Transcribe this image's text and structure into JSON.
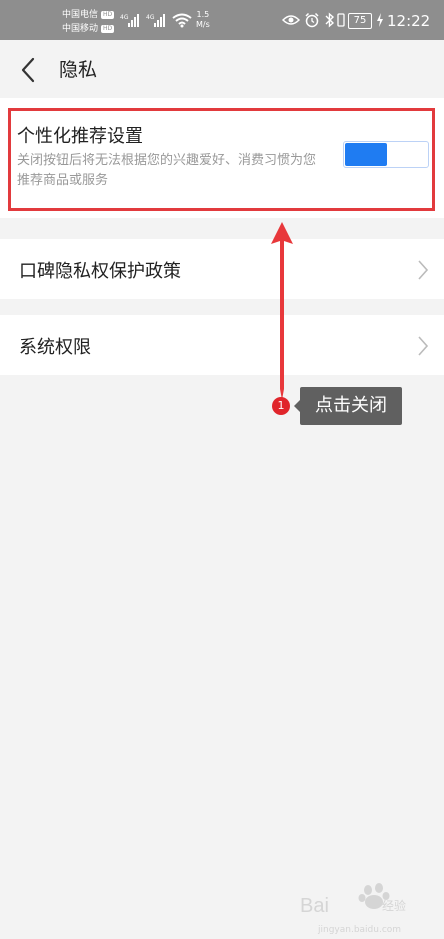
{
  "status_bar": {
    "carrier_1": "中国电信",
    "carrier_2": "中国移动",
    "hd_badge": "HD",
    "signal_1_label": "4G",
    "signal_2_label": "4G",
    "net_speed_value": "1.5",
    "net_speed_unit": "M/s",
    "battery_percent": "75",
    "time": "12:22"
  },
  "header": {
    "title": "隐私"
  },
  "recommendation": {
    "title": "个性化推荐设置",
    "description": "关闭按钮后将无法根据您的兴趣爱好、消费习惯为您推荐商品或服务",
    "toggle_on": true,
    "toggle_color": "#1f7cf2"
  },
  "menu": {
    "policy_label": "口碑隐私权保护政策",
    "permissions_label": "系统权限"
  },
  "annotation": {
    "step_number": "1",
    "tooltip_text": "点击关闭",
    "highlight_color": "#e23a3d"
  },
  "watermark": {
    "brand": "Bai",
    "brand_suffix": "经验",
    "url": "jingyan.baidu.com"
  }
}
